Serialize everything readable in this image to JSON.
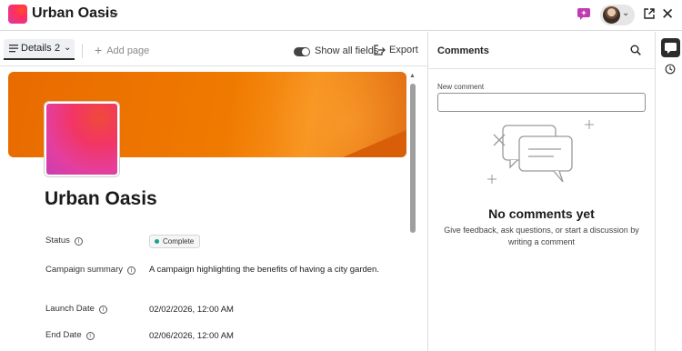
{
  "header": {
    "title": "Urban Oasis",
    "more_label": "···",
    "close_label": "✕",
    "pill_chevron": "⌄"
  },
  "toolbar": {
    "details_label": "Details",
    "details_count": "2",
    "details_chevron": "⌄",
    "add_page_plus": "+",
    "add_page_label": "Add page",
    "show_fields_label": "Show all fields",
    "export_label": "Export"
  },
  "record": {
    "title": "Urban Oasis",
    "fields": [
      {
        "label": "Status",
        "value": "Complete"
      },
      {
        "label": "Campaign summary",
        "value": "A campaign highlighting the benefits of having a city garden."
      },
      {
        "label": "Launch Date",
        "value": "02/02/2026, 12:00 AM"
      },
      {
        "label": "End Date",
        "value": "02/06/2026, 12:00 AM"
      }
    ],
    "info_glyph": "i",
    "status_color": "#17a589"
  },
  "comments": {
    "title": "Comments",
    "new_comment_label": "New comment",
    "empty_title": "No comments yet",
    "empty_desc": "Give feedback, ask questions, or start a discussion by writing a comment"
  },
  "colors": {
    "banner": "#f07a00",
    "thumbnail": "#e43e9f",
    "accent_dark": "#2c2c2c"
  },
  "icons": [
    "app-logo",
    "more-icon",
    "ai-assistant-icon",
    "avatar",
    "open-external-icon",
    "close-icon",
    "list-icon",
    "chevron-down-icon",
    "plus-icon",
    "toggle-switch",
    "export-icon",
    "info-icon",
    "search-icon",
    "comments-icon",
    "history-icon"
  ]
}
